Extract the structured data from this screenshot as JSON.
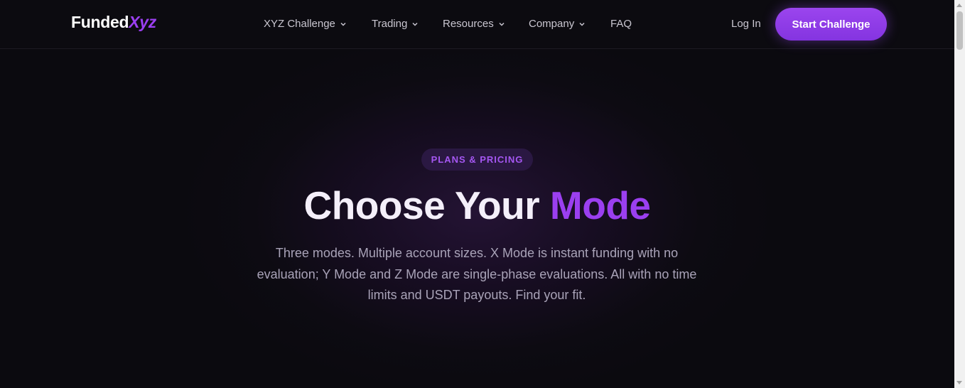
{
  "logo": {
    "part1": "Funded",
    "part2": "Xyz"
  },
  "nav": {
    "items": [
      {
        "label": "XYZ Challenge",
        "dropdown": true
      },
      {
        "label": "Trading",
        "dropdown": true
      },
      {
        "label": "Resources",
        "dropdown": true
      },
      {
        "label": "Company",
        "dropdown": true
      },
      {
        "label": "FAQ",
        "dropdown": false
      }
    ],
    "login": "Log In",
    "cta": "Start Challenge"
  },
  "hero": {
    "badge": "PLANS & PRICING",
    "title_part1": "Choose Your ",
    "title_part2": "Mode",
    "subtitle": "Three modes. Multiple account sizes. X Mode is instant funding with no evaluation; Y Mode and Z Mode are single-phase evaluations. All with no time limits and USDT payouts. Find your fit."
  },
  "colors": {
    "accent": "#9b3ff0",
    "background": "#0b0a0f",
    "badge_bg": "#2a1842"
  }
}
